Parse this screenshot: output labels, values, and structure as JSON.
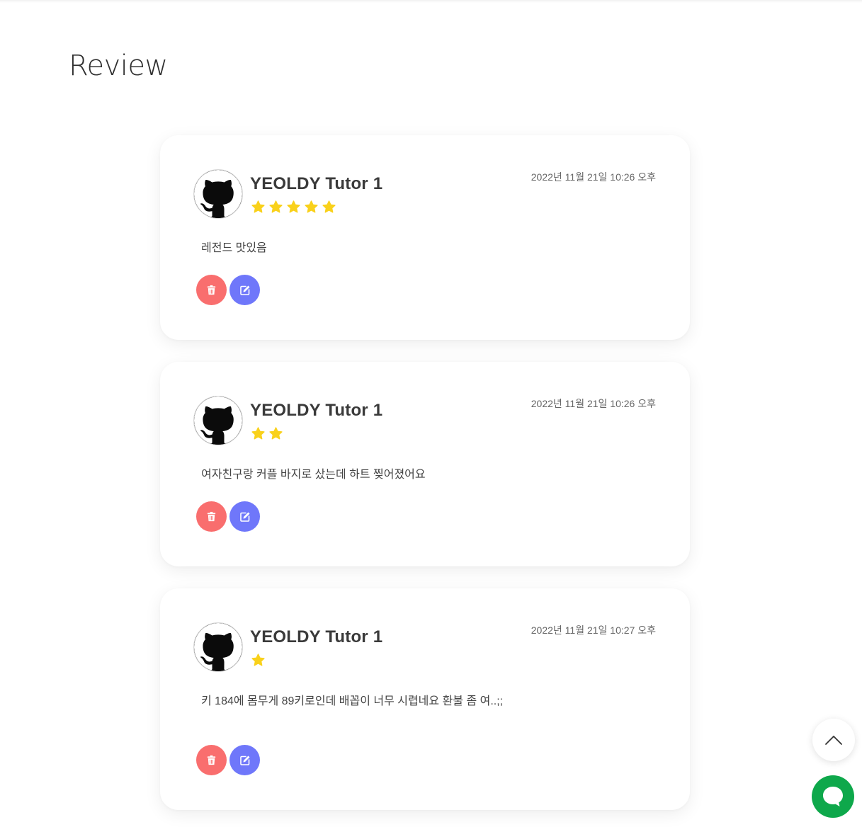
{
  "page": {
    "title": "Review"
  },
  "colors": {
    "star": "#f9d11b",
    "delete_button": "#f96e6e",
    "edit_button": "#6f77fa",
    "chat_button": "#0ea84b"
  },
  "icons": {
    "avatar": "github-icon",
    "delete": "trash-icon",
    "edit": "edit-icon",
    "scroll_top": "chevron-up-icon",
    "chat": "chat-bubble-icon"
  },
  "reviews": [
    {
      "author": "YEOLDY Tutor 1",
      "rating": 5,
      "date": "2022년 11월 21일 10:26 오후",
      "content": "레전드 맛있음"
    },
    {
      "author": "YEOLDY Tutor 1",
      "rating": 2,
      "date": "2022년 11월 21일 10:26 오후",
      "content": "여자친구랑 커플 바지로 샀는데 하트 찢어졌어요"
    },
    {
      "author": "YEOLDY Tutor 1",
      "rating": 1,
      "date": "2022년 11월 21일 10:27 오후",
      "content": "키 184에 몸무게 89키로인데 배꼽이 너무 시렵네요 환불 좀 여..;;"
    }
  ]
}
